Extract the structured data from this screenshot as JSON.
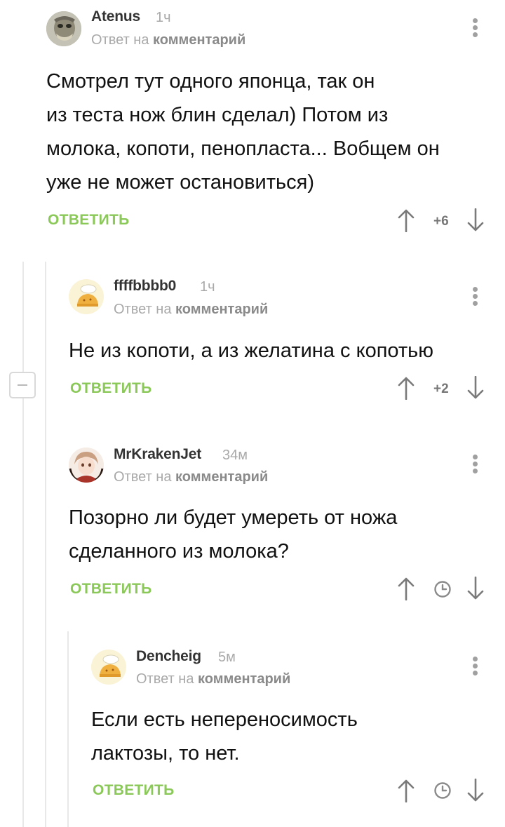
{
  "comments": [
    {
      "author": "Atenus",
      "time": "1ч",
      "reply_prefix": "Ответ на",
      "reply_link": "комментарий",
      "text_lines": [
        "Смотрел тут одного японца, так он",
        "из теста нож блин сделал) Потом из",
        "молока, копоти, пенопласта... Вобщем он",
        "уже не может остановиться)"
      ],
      "reply_label": "ОТВЕТИТЬ",
      "rating": "+6"
    },
    {
      "author": "ffffbbbb0",
      "time": "1ч",
      "reply_prefix": "Ответ на",
      "reply_link": "комментарий",
      "text_lines": [
        "Не из копоти, а из желатина с копотью"
      ],
      "reply_label": "ОТВЕТИТЬ",
      "rating": "+2"
    },
    {
      "author": "MrKrakenJet",
      "time": "34м",
      "reply_prefix": "Ответ на",
      "reply_link": "комментарий",
      "text_lines": [
        "Позорно ли будет умереть от ножа",
        "сделанного из молока?"
      ],
      "reply_label": "ОТВЕТИТЬ",
      "rating": "clock-icon"
    },
    {
      "author": "Dencheig",
      "time": "5м",
      "reply_prefix": "Ответ на",
      "reply_link": "комментарий",
      "text_lines": [
        "Если есть непереносимость",
        "лактозы, то нет."
      ],
      "reply_label": "ОТВЕТИТЬ",
      "rating": "clock-icon"
    }
  ],
  "colors": {
    "accent_green": "#8ac858",
    "muted_text": "#a9a9a9",
    "thread_line": "#e8e8e8"
  },
  "icons": [
    "arrow-up-icon",
    "arrow-down-icon",
    "clock-icon",
    "more-vertical-icon",
    "collapse-icon",
    "avatar-icon"
  ]
}
